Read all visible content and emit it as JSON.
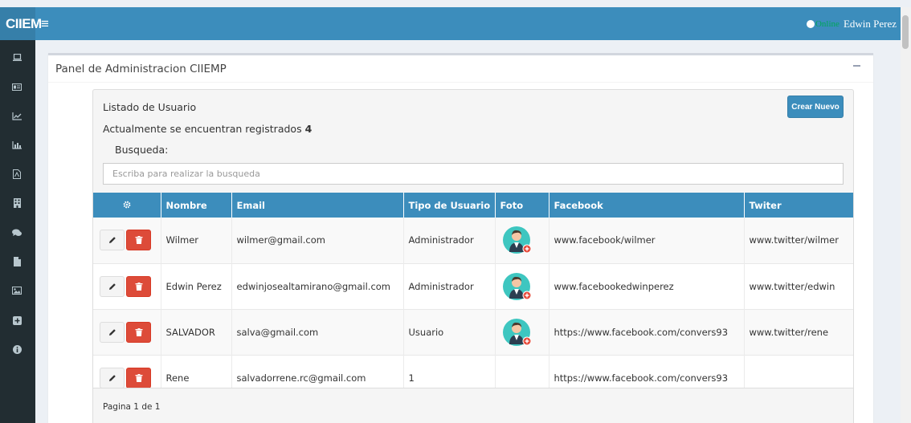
{
  "topbar": {
    "brand": "CIIEM",
    "online_label": "Online",
    "user_name": "Edwin Perez"
  },
  "sidebar": {
    "icons": [
      "laptop-icon",
      "id-card-icon",
      "line-chart-icon",
      "bar-chart-icon",
      "pdf-file-icon",
      "building-icon",
      "comments-icon",
      "file-icon",
      "image-icon",
      "plus-square-icon",
      "info-circle-icon"
    ]
  },
  "box": {
    "title": "Panel de Administracion CIIEMP"
  },
  "panel": {
    "list_title": "Listado de Usuario",
    "count_prefix": "Actualmente se encuentran registrados",
    "count_value": "4",
    "create_button": "Crear Nuevo",
    "search_label": "Busqueda:",
    "search_placeholder": "Escriba para realizar la busqueda"
  },
  "table": {
    "columns": [
      "Nombre",
      "Email",
      "Tipo de Usuario",
      "Foto",
      "Facebook",
      "Twiter"
    ],
    "rows": [
      {
        "nombre": "Wilmer",
        "email": "wilmer@gmail.com",
        "tipo": "Administrador",
        "has_photo": true,
        "facebook": "www.facebook/wilmer",
        "twitter": "www.twitter/wilmer"
      },
      {
        "nombre": "Edwin Perez",
        "email": "edwinjosealtamirano@gmail.com",
        "tipo": "Administrador",
        "has_photo": true,
        "facebook": "www.facebookedwinperez",
        "twitter": "www.twitter/edwin"
      },
      {
        "nombre": "SALVADOR",
        "email": "salva@gmail.com",
        "tipo": "Usuario",
        "has_photo": true,
        "facebook": "https://www.facebook.com/convers93",
        "twitter": "www.twitter/rene"
      },
      {
        "nombre": "Rene",
        "email": "salvadorrene.rc@gmail.com",
        "tipo": "1",
        "has_photo": false,
        "facebook": "https://www.facebook.com/convers93",
        "twitter": ""
      }
    ]
  },
  "pagination": {
    "text": "Pagina 1 de 1"
  },
  "colors": {
    "primary": "#3c8dbc",
    "sidebar": "#222d32",
    "danger": "#dd4b39",
    "online": "#00a65a"
  }
}
